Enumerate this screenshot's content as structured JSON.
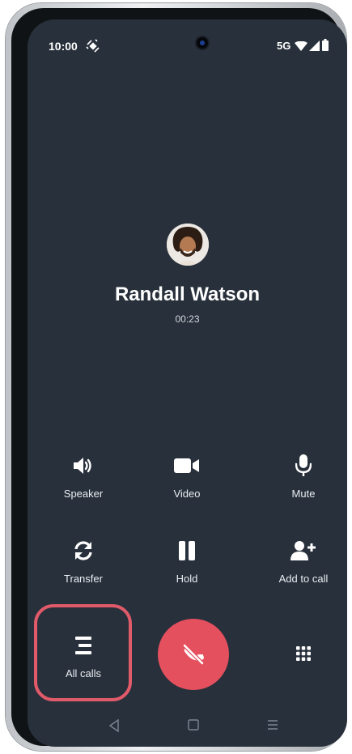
{
  "status_bar": {
    "time": "10:00",
    "network": "5G"
  },
  "caller": {
    "name": "Randall Watson",
    "duration": "00:23"
  },
  "actions": [
    {
      "label": "Speaker",
      "icon": "speaker-icon"
    },
    {
      "label": "Video",
      "icon": "video-camera-icon"
    },
    {
      "label": "Mute",
      "icon": "microphone-icon"
    },
    {
      "label": "Transfer",
      "icon": "transfer-icon"
    },
    {
      "label": "Hold",
      "icon": "pause-icon"
    },
    {
      "label": "Add to call",
      "icon": "add-person-icon"
    }
  ],
  "bottom": {
    "all_calls_label": "All calls",
    "end_call_icon": "end-call-icon",
    "keypad_icon": "dialpad-icon"
  },
  "colors": {
    "background": "#28303b",
    "end_call": "#e5505f",
    "highlight": "#e05a6a"
  }
}
